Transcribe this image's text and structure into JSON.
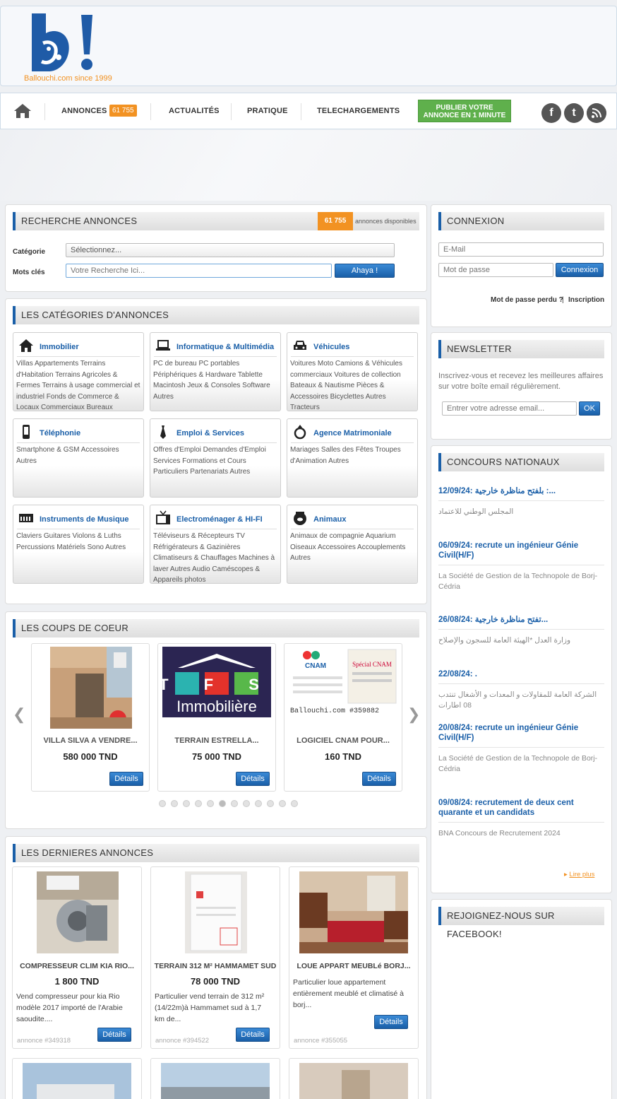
{
  "header": {
    "logo_text": "B!",
    "tagline": "Ballouchi.com since 1999"
  },
  "nav": {
    "home_icon": "home-icon",
    "items": [
      "ANNONCES",
      "ACTUALITÉS",
      "PRATIQUE",
      "TELECHARGEMENTS"
    ],
    "badge": "61 755",
    "publish": "PUBLIER VOTRE ANNONCE EN 1 MINUTE",
    "social": [
      "f",
      "t",
      "rss"
    ]
  },
  "search": {
    "title": "RECHERCHE ANNONCES",
    "count": "61 755",
    "count_suffix": "annonces disponibles",
    "category_label": "Catégorie",
    "category_value": "Sélectionnez...",
    "keywords_label": "Mots clés",
    "keywords_placeholder": "Votre Recherche Ici...",
    "button": "Ahaya !"
  },
  "categories": {
    "title": "LES CATÉGORIES D'ANNONCES",
    "items": [
      {
        "name": "Immobilier",
        "icon": "house-icon",
        "links": "Villas   Appartements   Terrains d'Habitation   Terrains Agricoles & Fermes   Terrains à usage commercial et industriel   Fonds de Commerce & Locaux Commerciaux   Bureaux"
      },
      {
        "name": "Informatique & Multimédia",
        "icon": "laptop-icon",
        "links": "PC de bureau   PC portables   Périphériques & Hardware   Tablette   Macintosh   Jeux & Consoles   Software   Autres"
      },
      {
        "name": "Véhicules",
        "icon": "car-icon",
        "links": "Voitures   Moto   Camions & Véhicules commerciaux   Voitures de collection   Bateaux & Nautisme   Pièces & Accessoires   Bicyclettes   Autres   Tracteurs"
      },
      {
        "name": "Téléphonie",
        "icon": "phone-icon",
        "links": "Smartphone & GSM   Accessoires   Autres"
      },
      {
        "name": "Emploi & Services",
        "icon": "tie-icon",
        "links": "Offres d'Emploi   Demandes d'Emploi   Services   Formations et Cours Particuliers   Partenariats   Autres"
      },
      {
        "name": "Agence Matrimoniale",
        "icon": "ring-icon",
        "links": "Mariages   Salles des Fêtes   Troupes d'Animation   Autres"
      },
      {
        "name": "Instruments de Musique",
        "icon": "piano-icon",
        "links": "Claviers   Guitares   Violons & Luths   Percussions   Matériels Sono   Autres"
      },
      {
        "name": "Electroménager & HI-FI",
        "icon": "tv-icon",
        "links": "Téléviseurs & Récepteurs TV   Réfrigérateurs & Gazinières   Climatiseurs & Chauffages   Machines à laver   Autres   Audio   Caméscopes & Appareils photos"
      },
      {
        "name": "Animaux",
        "icon": "fishbowl-icon",
        "links": "Animaux de compagnie   Aquarium   Oiseaux   Accessoires   Accouplements   Autres"
      }
    ]
  },
  "coups": {
    "title": "LES COUPS DE COEUR",
    "items": [
      {
        "title": "VILLA SILVA A VENDRE...",
        "price": "580 000 TND",
        "button": "Détails"
      },
      {
        "title": "TERRAIN ESTRELLA...",
        "price": "75 000 TND",
        "button": "Détails",
        "img_text1": "T F S",
        "img_text2": "Immobilière"
      },
      {
        "title": "LOGICIEL CNAM POUR...",
        "price": "160 TND",
        "button": "Détails",
        "img_text1": "CNAM",
        "img_text2": "Spécial CNAM",
        "img_text3": "Ballouchi.com #359882"
      }
    ],
    "dots": 12,
    "active_dot": 5
  },
  "last": {
    "title": "LES DERNIERES ANNONCES",
    "items": [
      {
        "title": "COMPRESSEUR CLIM KIA RIO...",
        "price": "1 800 TND",
        "desc": "Vend compresseur pour kia Rio modèle 2017 importé de l'Arabie saoudite....",
        "ref": "annonce #349318",
        "button": "Détails"
      },
      {
        "title": "TERRAIN 312 M² HAMMAMET SUD",
        "price": "78 000 TND",
        "desc": "Particulier vend terrain de 312 m² (14/22m)à Hammamet sud à 1,7 km de...",
        "ref": "annonce #394522",
        "button": "Détails"
      },
      {
        "title": "LOUE APPART MEUBLé BORJ...",
        "price": "",
        "desc": "Particulier loue appartement entièrement meublé et climatisé à borj...",
        "ref": "annonce #355055",
        "button": "Détails"
      }
    ]
  },
  "login": {
    "title": "CONNEXION",
    "email_placeholder": "E-Mail",
    "password_placeholder": "Mot de passe",
    "button": "Connexion",
    "lost": "Mot de passe perdu ?",
    "separator": "|",
    "signup": "Inscription"
  },
  "newsletter": {
    "title": "NEWSLETTER",
    "text": "Inscrivez-vous et recevez les meilleures affaires sur votre boîte email régulièrement.",
    "placeholder": "Entrer votre adresse email...",
    "button": "OK"
  },
  "concours": {
    "title": "CONCOURS NATIONAUX",
    "items": [
      {
        "title": "12/09/24: بلفتح مناظرة خارجية :...",
        "desc": "المجلس الوطني للاعتماد"
      },
      {
        "title": "06/09/24: recrute un ingénieur Génie Civil(H/F)",
        "desc": "La Société de Gestion de la Technopole de Borj-Cédria"
      },
      {
        "title": "26/08/24: تفتح مناظرة خارجية...",
        "desc": "وزارة العدل *الهيئة العامة للسجون والإصلاح"
      },
      {
        "title": "22/08/24: .",
        "desc": "الشركة العامة للمقاولات و المعدات و الأشغال تنتدب 08 اطارات"
      },
      {
        "title": "20/08/24: recrute un ingénieur Génie Civil(H/F)",
        "desc": "La Société de Gestion de la Technopole de Borj-Cédria"
      },
      {
        "title": "09/08/24: recrutement de deux cent quarante et un candidats",
        "desc": "BNA Concours de Recrutement 2024"
      }
    ],
    "more": "Lire plus"
  },
  "facebook": {
    "title": "REJOIGNEZ-NOUS SUR FACEBOOK!"
  },
  "colors": {
    "accent": "#1a5fa8",
    "orange": "#f29222",
    "green": "#5fb04c"
  }
}
